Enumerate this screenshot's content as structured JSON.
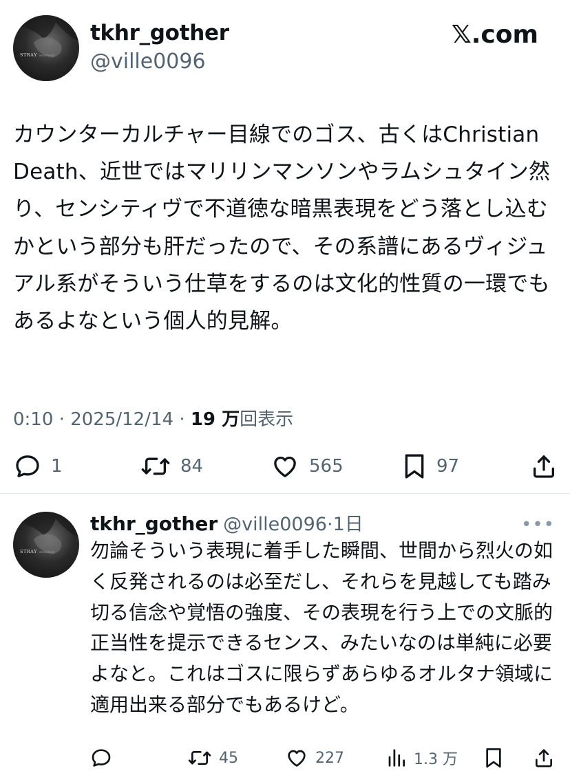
{
  "tweet": {
    "display_name": "tkhr_gother",
    "handle": "@ville0096",
    "brand": "𝕏.com",
    "text": "カウンターカルチャー目線でのゴス、古くはChristian Death、近世ではマリリンマンソンやラムシュタイン然り、センシティヴで不道徳な暗黒表現をどう落とし込むかという部分も肝だったので、その系譜にあるヴィジュアル系がそういう仕草をするのは文化的性質の一環でもあるよなという個人的見解。",
    "time": "0:10",
    "date": "2025/12/14",
    "views_count": "19 万",
    "views_label": "回表示",
    "replies": "1",
    "retweets": "84",
    "likes": "565",
    "bookmarks": "97",
    "avatar_text": "STRAY"
  },
  "reply": {
    "display_name": "tkhr_gother",
    "handle": "@ville0096",
    "separator": "·",
    "time": "1日",
    "text": "勿論そういう表現に着手した瞬間、世間から烈火の如く反発されるのは必至だし、それらを見越しても踏み切る信念や覚悟の強度、その表現を行う上での文脈的正当性を提示できるセンス、みたいなのは単純に必要よなと。これはゴスに限らずあらゆるオルタナ領域に適用出来る部分でもあるけど。",
    "more": "•••",
    "retweets": "45",
    "likes": "227",
    "views": "1.3 万",
    "avatar_text": "STRAY"
  },
  "icons": {
    "reply": "speech-bubble-icon",
    "retweet": "retweet-arrows-icon",
    "like": "heart-icon",
    "bookmark": "bookmark-icon",
    "share": "share-upload-icon",
    "views": "bar-chart-icon"
  },
  "colors": {
    "text": "#0f1419",
    "secondary": "#536471",
    "divider": "#e3e8eb"
  }
}
